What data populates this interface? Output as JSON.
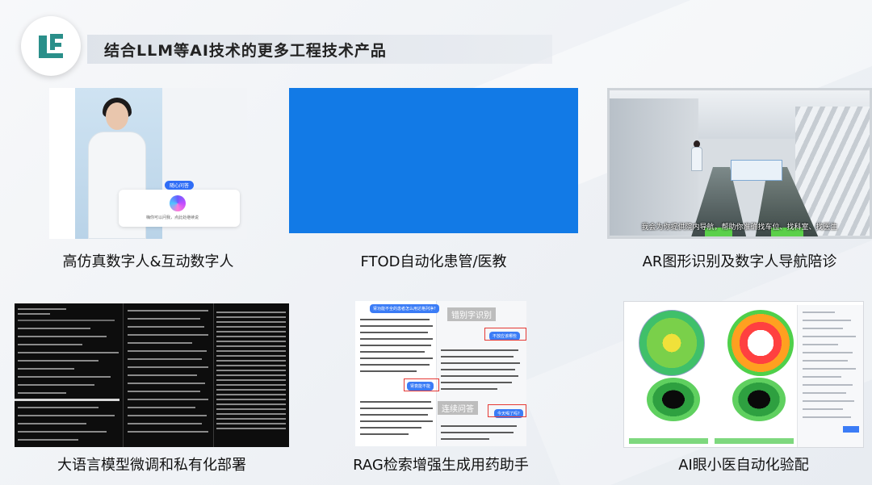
{
  "header": {
    "title": "结合LLM等AI技术的更多工程技术产品"
  },
  "products": [
    {
      "caption": "高仿真数字人&互动数字人",
      "screen_pill": "随心问答",
      "screen_text": "嗨你可以问我，点此处继续说"
    },
    {
      "caption": "FTOD自动化患管/医教"
    },
    {
      "caption": "AR图形识别及数字人导航陪诊",
      "screen_subtitle": "我会为你提供院内导航，帮助你准确找车位、找科室、找医生"
    },
    {
      "caption": "大语言模型微调和私有化部署"
    },
    {
      "caption": "RAG检索增强生成用药助手",
      "screen_tags": [
        "错别字识别",
        "连续问答"
      ],
      "screen_bubbles": [
        "肾功能不全的患者怎么用达格列净?",
        "不放应该哪些",
        "肾衰能不能",
        "今天喝了吗?"
      ]
    },
    {
      "caption": "AI眼小医自动化验配"
    }
  ],
  "colors": {
    "ftod_block": "#127ae6",
    "logo_teal": "#2a8f8a",
    "rag_bubble": "#3b7cf6",
    "rag_highlight": "#e53935"
  }
}
